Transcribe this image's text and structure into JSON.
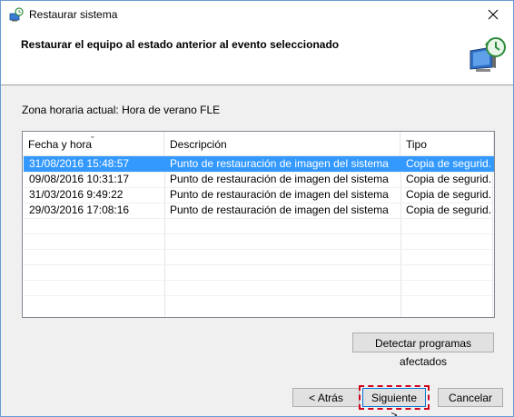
{
  "window": {
    "title": "Restaurar sistema",
    "close_symbol": "✕"
  },
  "header": {
    "title": "Restaurar el equipo al estado anterior al evento seleccionado",
    "icon": "system-restore-icon"
  },
  "timezone_label": "Zona horaria actual: Hora de verano FLE",
  "list": {
    "columns": [
      "Fecha y hora",
      "Descripción",
      "Tipo"
    ],
    "sort_indicator": "⌄",
    "rows": [
      {
        "date": "31/08/2016 15:48:57",
        "description": "Punto de restauración de imagen del sistema",
        "type": "Copia de segurid...",
        "selected": true
      },
      {
        "date": "09/08/2016 10:31:17",
        "description": "Punto de restauración de imagen del sistema",
        "type": "Copia de segurid...",
        "selected": false
      },
      {
        "date": "31/03/2016 9:49:22",
        "description": "Punto de restauración de imagen del sistema",
        "type": "Copia de segurid...",
        "selected": false
      },
      {
        "date": "29/03/2016 17:08:16",
        "description": "Punto de restauración de imagen del sistema",
        "type": "Copia de segurid...",
        "selected": false
      }
    ]
  },
  "buttons": {
    "detect": "Detectar programas afectados",
    "back": "< Atrás",
    "next": "Siguiente >",
    "cancel": "Cancelar"
  },
  "colors": {
    "selection": "#3399ff",
    "focus_highlight": "#d0021b",
    "window_border": "#6b9bd1"
  }
}
